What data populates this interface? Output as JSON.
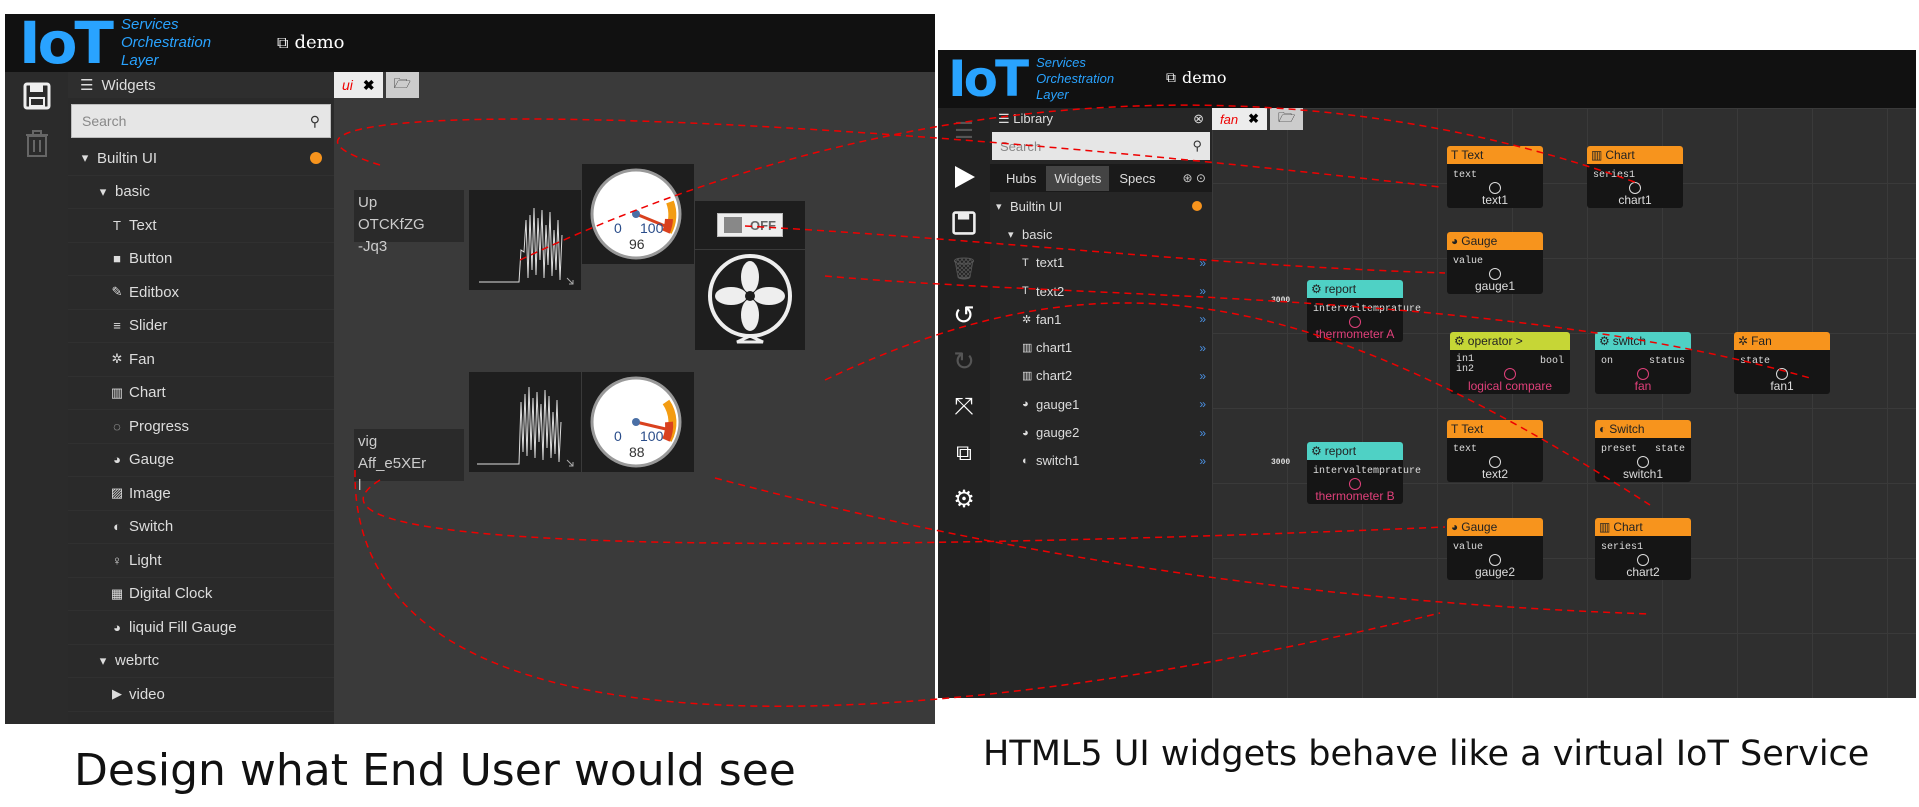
{
  "left_app": {
    "logo": {
      "text": "IoT",
      "tagline": [
        "Services",
        "Orchestration",
        "Layer"
      ]
    },
    "project": "demo",
    "toolbar_icons": [
      "save-icon",
      "trash-icon"
    ],
    "panel_title": "Widgets",
    "search_placeholder": "Search",
    "tree": [
      {
        "label": "Builtin UI",
        "level": 0,
        "kind": "group"
      },
      {
        "label": "basic",
        "level": 1,
        "kind": "group"
      },
      {
        "label": "Text",
        "level": 2,
        "icon": "T"
      },
      {
        "label": "Button",
        "level": 2,
        "icon": "■"
      },
      {
        "label": "Editbox",
        "level": 2,
        "icon": "✎"
      },
      {
        "label": "Slider",
        "level": 2,
        "icon": "≡"
      },
      {
        "label": "Fan",
        "level": 2,
        "icon": "✲"
      },
      {
        "label": "Chart",
        "level": 2,
        "icon": "▥"
      },
      {
        "label": "Progress",
        "level": 2,
        "icon": "◌"
      },
      {
        "label": "Gauge",
        "level": 2,
        "icon": "◕"
      },
      {
        "label": "Image",
        "level": 2,
        "icon": "▨"
      },
      {
        "label": "Switch",
        "level": 2,
        "icon": "◐"
      },
      {
        "label": "Light",
        "level": 2,
        "icon": "♀"
      },
      {
        "label": "Digital Clock",
        "level": 2,
        "icon": "▦"
      },
      {
        "label": "liquid Fill Gauge",
        "level": 2,
        "icon": "◕"
      },
      {
        "label": "webrtc",
        "level": 1,
        "kind": "group"
      },
      {
        "label": "video",
        "level": 2,
        "icon": "▶"
      }
    ],
    "stage_tab": "ui",
    "text_widget_1": [
      "Up",
      "OTCKfZG",
      "-Jq3"
    ],
    "text_widget_2": [
      "vig",
      "Aff_e5XEr",
      "l"
    ],
    "gauge1": {
      "min": "0",
      "max": "100",
      "value": "96",
      "level": 0.96
    },
    "gauge2": {
      "min": "0",
      "max": "100",
      "value": "88",
      "level": 0.88
    },
    "switch_label": "OFF"
  },
  "right_app": {
    "logo": {
      "text": "IoT",
      "tagline": [
        "Services",
        "Orchestration",
        "Layer"
      ]
    },
    "project": "demo",
    "panel_title": "Library",
    "search_placeholder": "Search",
    "lib_tabs": [
      "Hubs",
      "Widgets",
      "Specs"
    ],
    "tree": [
      {
        "label": "Builtin UI",
        "level": 0
      },
      {
        "label": "basic",
        "level": 1
      },
      {
        "label": "text1",
        "icon": "T"
      },
      {
        "label": "text2",
        "icon": "T"
      },
      {
        "label": "fan1",
        "icon": "✲"
      },
      {
        "label": "chart1",
        "icon": "▥"
      },
      {
        "label": "chart2",
        "icon": "▥"
      },
      {
        "label": "gauge1",
        "icon": "◕"
      },
      {
        "label": "gauge2",
        "icon": "◕"
      },
      {
        "label": "switch1",
        "icon": "◐"
      }
    ],
    "canvas_tab": "fan",
    "nodes": {
      "text_a": {
        "title": "Text",
        "in": "text",
        "name": "text1"
      },
      "chart_a": {
        "title": "Chart",
        "in": "series1",
        "name": "chart1"
      },
      "gauge_a": {
        "title": "Gauge",
        "in": "value",
        "name": "gauge1"
      },
      "report_a": {
        "title": "report",
        "port": "intervaltemprature",
        "input": "3000",
        "name": "thermometer A"
      },
      "operator": {
        "title": "operator >",
        "in1": "in1",
        "in2": "in2",
        "out": "bool",
        "name": "logical compare"
      },
      "switch_svc": {
        "title": "switch",
        "in": "on",
        "out": "status",
        "name": "fan"
      },
      "fan": {
        "title": "Fan",
        "in": "state",
        "name": "fan1"
      },
      "text_b": {
        "title": "Text",
        "in": "text",
        "name": "text2"
      },
      "switch_w": {
        "title": "Switch",
        "in": "preset",
        "out": "state",
        "name": "switch1"
      },
      "report_b": {
        "title": "report",
        "port": "intervaltemprature",
        "input": "3000",
        "name": "thermometer B"
      },
      "gauge_b": {
        "title": "Gauge",
        "in": "value",
        "name": "gauge2"
      },
      "chart_b": {
        "title": "Chart",
        "in": "series1",
        "name": "chart2"
      }
    }
  },
  "captions": {
    "left": "Design what End User would see",
    "right": "HTML5 UI widgets behave like a virtual IoT Service"
  },
  "colors": {
    "accent": "#29a3ff",
    "widget_node": "#f7941d",
    "service_node": "#4fd1c5",
    "operator_node": "#c6d636",
    "link": "#ff0000"
  }
}
